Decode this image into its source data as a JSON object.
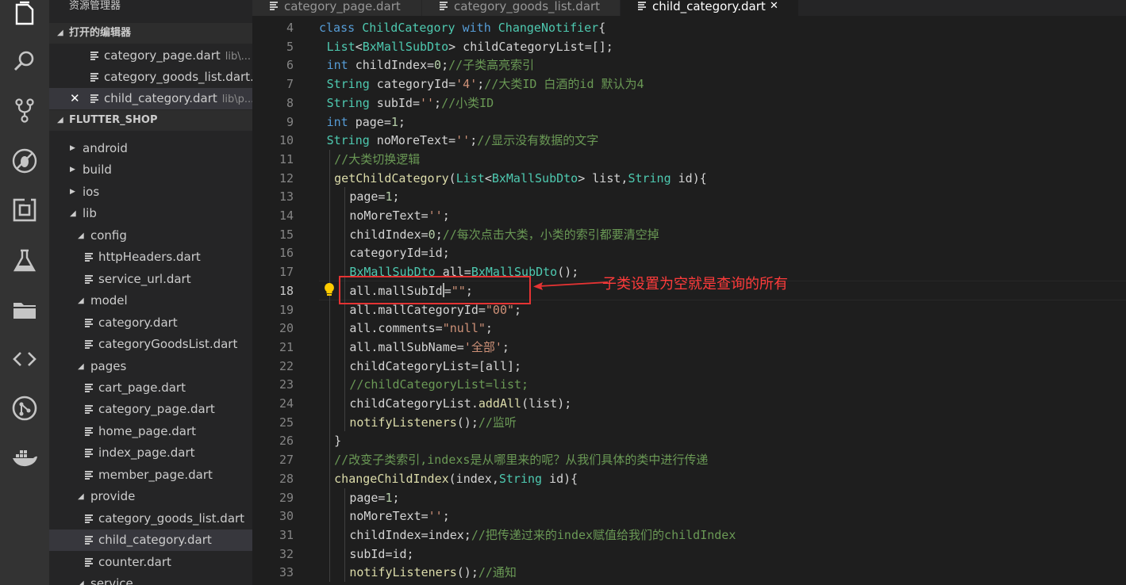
{
  "sidebar": {
    "title": "资源管理器",
    "open_editors_label": "打开的编辑器",
    "open_editors": [
      {
        "name": "category_page.dart",
        "path": "lib\\...",
        "selected": false,
        "close": false
      },
      {
        "name": "category_goods_list.dart...",
        "path": "",
        "selected": false,
        "close": false
      },
      {
        "name": "child_category.dart",
        "path": "lib\\p...",
        "selected": true,
        "close": true
      }
    ],
    "close_glyph": "✕",
    "project_label": "FLUTTER_SHOP",
    "tree": [
      {
        "label": "android",
        "kind": "folder",
        "depth": 0,
        "expanded": false
      },
      {
        "label": "build",
        "kind": "folder",
        "depth": 0,
        "expanded": false
      },
      {
        "label": "ios",
        "kind": "folder",
        "depth": 0,
        "expanded": false
      },
      {
        "label": "lib",
        "kind": "folder",
        "depth": 0,
        "expanded": true
      },
      {
        "label": "config",
        "kind": "folder",
        "depth": 1,
        "expanded": true
      },
      {
        "label": "httpHeaders.dart",
        "kind": "file",
        "depth": 2
      },
      {
        "label": "service_url.dart",
        "kind": "file",
        "depth": 2
      },
      {
        "label": "model",
        "kind": "folder",
        "depth": 1,
        "expanded": true
      },
      {
        "label": "category.dart",
        "kind": "file",
        "depth": 2
      },
      {
        "label": "categoryGoodsList.dart",
        "kind": "file",
        "depth": 2
      },
      {
        "label": "pages",
        "kind": "folder",
        "depth": 1,
        "expanded": true
      },
      {
        "label": "cart_page.dart",
        "kind": "file",
        "depth": 2
      },
      {
        "label": "category_page.dart",
        "kind": "file",
        "depth": 2
      },
      {
        "label": "home_page.dart",
        "kind": "file",
        "depth": 2
      },
      {
        "label": "index_page.dart",
        "kind": "file",
        "depth": 2
      },
      {
        "label": "member_page.dart",
        "kind": "file",
        "depth": 2
      },
      {
        "label": "provide",
        "kind": "folder",
        "depth": 1,
        "expanded": true
      },
      {
        "label": "category_goods_list.dart",
        "kind": "file",
        "depth": 2
      },
      {
        "label": "child_category.dart",
        "kind": "file",
        "depth": 2,
        "selected": true
      },
      {
        "label": "counter.dart",
        "kind": "file",
        "depth": 2
      },
      {
        "label": "service",
        "kind": "folder",
        "depth": 1,
        "expanded": true
      }
    ]
  },
  "tabs": [
    {
      "label": "category_page.dart",
      "active": false
    },
    {
      "label": "category_goods_list.dart",
      "active": false
    },
    {
      "label": "child_category.dart",
      "active": true
    }
  ],
  "tab_close_glyph": "✕",
  "activity_icons": [
    "files-icon",
    "search-icon",
    "source-control-icon",
    "debug-icon",
    "extensions-icon",
    "flask-icon",
    "folder-icon",
    "code-icon",
    "git-history-icon",
    "docker-icon"
  ],
  "editor": {
    "current_line": 18,
    "lines": [
      {
        "n": 4,
        "indent": 0,
        "tokens": [
          [
            "k",
            "class "
          ],
          [
            "t",
            "ChildCategory "
          ],
          [
            "k",
            "with "
          ],
          [
            "t",
            "ChangeNotifier"
          ],
          [
            "p",
            "{"
          ]
        ]
      },
      {
        "n": 5,
        "indent": 1,
        "tokens": [
          [
            "t",
            "List"
          ],
          [
            "p",
            "<"
          ],
          [
            "t",
            "BxMallSubDto"
          ],
          [
            "p",
            "> childCategoryList=[];"
          ]
        ]
      },
      {
        "n": 6,
        "indent": 1,
        "tokens": [
          [
            "k",
            "int "
          ],
          [
            "p",
            "childIndex="
          ],
          [
            "n",
            "0"
          ],
          [
            "p",
            ";"
          ],
          [
            "c",
            "//子类高亮索引"
          ]
        ]
      },
      {
        "n": 7,
        "indent": 1,
        "tokens": [
          [
            "t",
            "String "
          ],
          [
            "p",
            "categoryId="
          ],
          [
            "s",
            "'4'"
          ],
          [
            "p",
            ";"
          ],
          [
            "c",
            "//大类ID 白酒的id 默认为4"
          ]
        ]
      },
      {
        "n": 8,
        "indent": 1,
        "tokens": [
          [
            "t",
            "String "
          ],
          [
            "p",
            "subId="
          ],
          [
            "s",
            "''"
          ],
          [
            "p",
            ";"
          ],
          [
            "c",
            "//小类ID"
          ]
        ]
      },
      {
        "n": 9,
        "indent": 1,
        "tokens": [
          [
            "k",
            "int "
          ],
          [
            "p",
            "page="
          ],
          [
            "n",
            "1"
          ],
          [
            "p",
            ";"
          ]
        ]
      },
      {
        "n": 10,
        "indent": 1,
        "tokens": [
          [
            "t",
            "String "
          ],
          [
            "p",
            "noMoreText="
          ],
          [
            "s",
            "''"
          ],
          [
            "p",
            ";"
          ],
          [
            "c",
            "//显示没有数据的文字"
          ]
        ]
      },
      {
        "n": 11,
        "indent": 2,
        "tokens": [
          [
            "c",
            "//大类切换逻辑"
          ]
        ]
      },
      {
        "n": 12,
        "indent": 2,
        "tokens": [
          [
            "f",
            "getChildCategory"
          ],
          [
            "p",
            "("
          ],
          [
            "t",
            "List"
          ],
          [
            "p",
            "<"
          ],
          [
            "t",
            "BxMallSubDto"
          ],
          [
            "p",
            "> list,"
          ],
          [
            "t",
            "String "
          ],
          [
            "p",
            "id){"
          ]
        ]
      },
      {
        "n": 13,
        "indent": 4,
        "tokens": [
          [
            "p",
            "page="
          ],
          [
            "n",
            "1"
          ],
          [
            "p",
            ";"
          ]
        ]
      },
      {
        "n": 14,
        "indent": 4,
        "tokens": [
          [
            "p",
            "noMoreText="
          ],
          [
            "s",
            "''"
          ],
          [
            "p",
            ";"
          ]
        ]
      },
      {
        "n": 15,
        "indent": 4,
        "tokens": [
          [
            "p",
            "childIndex="
          ],
          [
            "n",
            "0"
          ],
          [
            "p",
            ";"
          ],
          [
            "c",
            "//每次点击大类，小类的索引都要清空掉"
          ]
        ]
      },
      {
        "n": 16,
        "indent": 4,
        "tokens": [
          [
            "p",
            "categoryId=id;"
          ]
        ]
      },
      {
        "n": 17,
        "indent": 4,
        "tokens": [
          [
            "t",
            "BxMallSubDto "
          ],
          [
            "p",
            "all="
          ],
          [
            "t",
            "BxMallSubDto"
          ],
          [
            "p",
            "();"
          ]
        ]
      },
      {
        "n": 18,
        "indent": 4,
        "tokens": [
          [
            "p",
            "all.mallSubId"
          ],
          [
            "caret",
            ""
          ],
          [
            "p",
            "="
          ],
          [
            "s",
            "\"\""
          ],
          [
            "p",
            ";"
          ]
        ]
      },
      {
        "n": 19,
        "indent": 4,
        "tokens": [
          [
            "p",
            "all.mallCategoryId="
          ],
          [
            "s",
            "\"00\""
          ],
          [
            "p",
            ";"
          ]
        ]
      },
      {
        "n": 20,
        "indent": 4,
        "tokens": [
          [
            "p",
            "all.comments="
          ],
          [
            "s",
            "\"null\""
          ],
          [
            "p",
            ";"
          ]
        ]
      },
      {
        "n": 21,
        "indent": 4,
        "tokens": [
          [
            "p",
            "all.mallSubName="
          ],
          [
            "s",
            "'全部'"
          ],
          [
            "p",
            ";"
          ]
        ]
      },
      {
        "n": 22,
        "indent": 4,
        "tokens": [
          [
            "p",
            "childCategoryList=[all];"
          ]
        ]
      },
      {
        "n": 23,
        "indent": 4,
        "tokens": [
          [
            "c",
            "//childCategoryList=list;"
          ]
        ]
      },
      {
        "n": 24,
        "indent": 4,
        "tokens": [
          [
            "p",
            "childCategoryList."
          ],
          [
            "f",
            "addAll"
          ],
          [
            "p",
            "(list);"
          ]
        ]
      },
      {
        "n": 25,
        "indent": 4,
        "tokens": [
          [
            "f",
            "notifyListeners"
          ],
          [
            "p",
            "();"
          ],
          [
            "c",
            "//监听"
          ]
        ]
      },
      {
        "n": 26,
        "indent": 2,
        "tokens": [
          [
            "p",
            "}"
          ]
        ]
      },
      {
        "n": 27,
        "indent": 2,
        "tokens": [
          [
            "c",
            "//改变子类索引,indexs是从哪里来的呢？从我们具体的类中进行传递"
          ]
        ]
      },
      {
        "n": 28,
        "indent": 2,
        "tokens": [
          [
            "f",
            "changeChildIndex"
          ],
          [
            "p",
            "(index,"
          ],
          [
            "t",
            "String "
          ],
          [
            "p",
            "id){"
          ]
        ]
      },
      {
        "n": 29,
        "indent": 4,
        "tokens": [
          [
            "p",
            "page="
          ],
          [
            "n",
            "1"
          ],
          [
            "p",
            ";"
          ]
        ]
      },
      {
        "n": 30,
        "indent": 4,
        "tokens": [
          [
            "p",
            "noMoreText="
          ],
          [
            "s",
            "''"
          ],
          [
            "p",
            ";"
          ]
        ]
      },
      {
        "n": 31,
        "indent": 4,
        "tokens": [
          [
            "p",
            "childIndex=index;"
          ],
          [
            "c",
            "//把传递过来的index赋值给我们的childIndex"
          ]
        ]
      },
      {
        "n": 32,
        "indent": 4,
        "tokens": [
          [
            "p",
            "subId=id;"
          ]
        ]
      },
      {
        "n": 33,
        "indent": 4,
        "tokens": [
          [
            "f",
            "notifyListeners"
          ],
          [
            "p",
            "();"
          ],
          [
            "c",
            "//通知"
          ]
        ]
      }
    ]
  },
  "annotation": {
    "text": "子类设置为空就是查询的所有",
    "color": "#e53333"
  },
  "colors": {
    "keyword": "#569cd6",
    "type": "#4ec9b0",
    "string": "#ce9178",
    "comment": "#6a9955",
    "function": "#dcdcaa",
    "number": "#b5cea8"
  }
}
